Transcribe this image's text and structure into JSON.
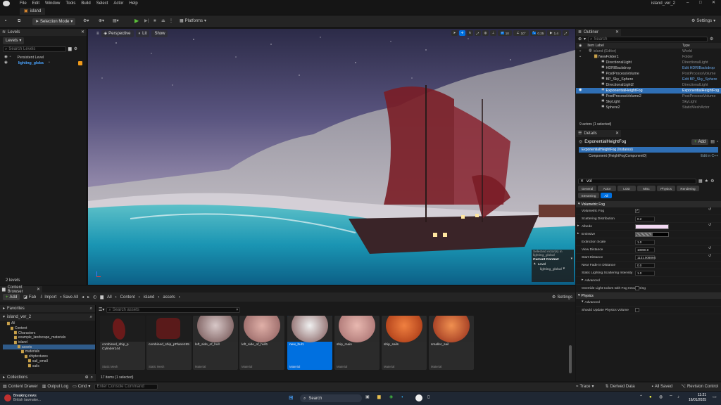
{
  "menu": {
    "items": [
      "File",
      "Edit",
      "Window",
      "Tools",
      "Build",
      "Select",
      "Actor",
      "Help"
    ],
    "project_name": "island_ver_2"
  },
  "tab": {
    "label": "island"
  },
  "toolbar": {
    "selection_mode": "Selection Mode",
    "platforms": "Platforms",
    "settings": "Settings"
  },
  "levels": {
    "tab": "Levels",
    "dropdown": "Levels",
    "search_placeholder": "Search Levels",
    "items": [
      "Persistent Level",
      "lighting_globa"
    ],
    "count": "2 levels"
  },
  "viewport": {
    "perspective": "Perspective",
    "lit": "Lit",
    "show": "Show",
    "grid_value": "10",
    "angle_value": "10°",
    "scale_value": "0.25",
    "camera_speed": "1.4",
    "overlay": {
      "selected_actors": "Selected Actor(s) in",
      "level_name": "lighting_global",
      "current_context": "Current Context",
      "level_label": "Level",
      "level_value": "lighting_global"
    }
  },
  "outliner": {
    "tab": "Outliner",
    "search_placeholder": "Search",
    "col_label": "Item Label",
    "col_type": "Type",
    "rows": [
      {
        "label": "island (Editor)",
        "type": "World"
      },
      {
        "label": "NewFolder1",
        "type": "Folder"
      },
      {
        "label": "DirectionalLight",
        "type": "DirectionalLight"
      },
      {
        "label": "HDRIBackdrop",
        "type": "Edit HDRIBackdrop"
      },
      {
        "label": "PostProcessVolume",
        "type": "PostProcessVolume"
      },
      {
        "label": "BP_Sky_Sphere",
        "type": "Edit BP_Sky_Sphere"
      },
      {
        "label": "DirectionalLight2",
        "type": "DirectionalLight"
      },
      {
        "label": "ExponentialHeightFog",
        "type": "ExponentialHeightFog"
      },
      {
        "label": "PostProcessVolume2",
        "type": "PostProcessVolume"
      },
      {
        "label": "SkyLight",
        "type": "SkyLight"
      },
      {
        "label": "Sphere2",
        "type": "StaticMeshActor"
      }
    ],
    "status": "9 actors (1 selected)"
  },
  "details": {
    "tab": "Details",
    "actor_name": "ExponentialHeightFog",
    "add_label": "Add",
    "instance_label": "ExponentialHeightFog (Instance)",
    "component_label": "Component (HeightFogComponent0)",
    "edit_cpp": "Edit in C++",
    "search_value": "vol",
    "filter_tabs": [
      "General",
      "Actor",
      "LOD",
      "Misc",
      "Physics",
      "Rendering",
      "Streaming",
      "All"
    ],
    "section_fog": "Volumetric Fog",
    "props": [
      {
        "name": "Volumetric Fog",
        "value": ""
      },
      {
        "name": "Scattering Distribution",
        "value": "0.2"
      },
      {
        "name": "Albedo",
        "value": ""
      },
      {
        "name": "Emissive",
        "value": ""
      },
      {
        "name": "Extinction Scale",
        "value": "1.0"
      },
      {
        "name": "View Distance",
        "value": "10000.0"
      },
      {
        "name": "Start Distance",
        "value": "1131.008894"
      },
      {
        "name": "Near Fade In Distance",
        "value": "0.0"
      },
      {
        "name": "Static Lighting Scattering Intensity",
        "value": "1.0"
      }
    ],
    "advanced": "Advanced",
    "override_label": "Override Light Colors with Fog Inscattering",
    "section_physics": "Physics",
    "advanced2": "Advanced",
    "should_update": "Should Update Physics Volume"
  },
  "content_browser": {
    "tab": "Content Browser",
    "add": "Add",
    "fab": "Fab",
    "import": "Import",
    "save_all": "Save All",
    "settings": "Settings",
    "breadcrumb": [
      "All",
      "Content",
      "island",
      "assets"
    ],
    "favorites": "Favorites",
    "project": "island_ver_2",
    "search_placeholder": "Search assets",
    "tree": [
      "All",
      "Content",
      "Characters",
      "example_landscape_materials",
      "island",
      "assets",
      "materials",
      "shiptextures",
      "sail_small",
      "sails"
    ],
    "collections": "Collections",
    "assets": [
      {
        "name": "combined_ship_p Cylinder144",
        "type": "Static Mesh"
      },
      {
        "name": "combined_ship_pPlane195",
        "type": "Static Mesh"
      },
      {
        "name": "left_side_of_hull",
        "type": "Material"
      },
      {
        "name": "left_side_of_hull1",
        "type": "Material"
      },
      {
        "name": "new_hul1",
        "type": "Material"
      },
      {
        "name": "ship_main",
        "type": "Material"
      },
      {
        "name": "ship_sails",
        "type": "Material"
      },
      {
        "name": "smaller_sail",
        "type": "Material"
      }
    ],
    "status": "17 items (1 selected)"
  },
  "statusbar": {
    "content_drawer": "Content Drawer",
    "output_log": "Output Log",
    "cmd": "Cmd",
    "console_placeholder": "Enter Console Command",
    "trace": "Trace",
    "derived_data": "Derived Data",
    "all_saved": "All Saved",
    "revision_control": "Revision Control"
  },
  "taskbar": {
    "news_title": "Breaking news",
    "news_sub": "British lawmake...",
    "search": "Search",
    "time": "11:21",
    "date": "16/01/2025"
  },
  "colors": {
    "accent": "#0070e0",
    "selection": "#2f6fb5",
    "folder": "#c9a14a"
  }
}
